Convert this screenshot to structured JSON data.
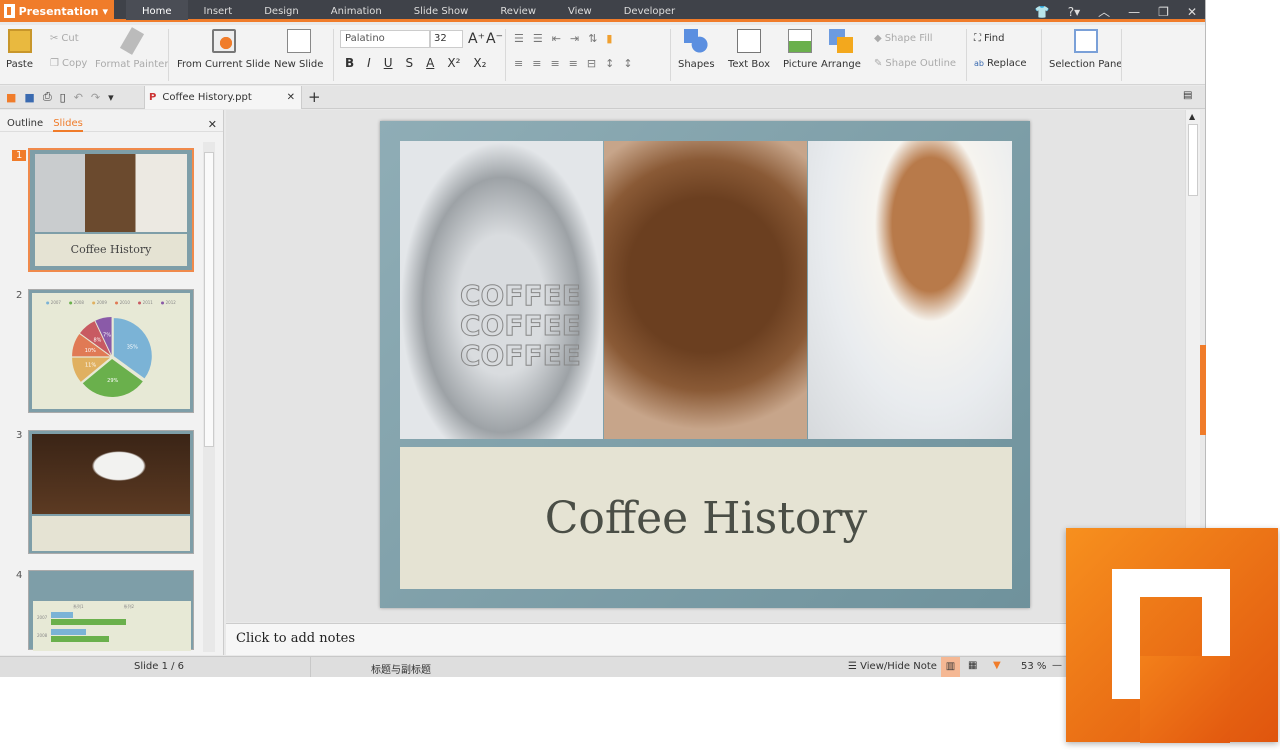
{
  "app": {
    "name": "Presentation",
    "tabs": [
      "Home",
      "Insert",
      "Design",
      "Animation",
      "Slide Show",
      "Review",
      "View",
      "Developer"
    ],
    "active_tab": "Home",
    "accent": "#f07c2a"
  },
  "ribbon": {
    "paste": "Paste",
    "cut": "Cut",
    "copy": "Copy",
    "format_painter": "Format Painter",
    "from_current_slide": "From Current Slide",
    "new_slide": "New Slide",
    "font": "Palatino",
    "font_size": "32",
    "bold": "B",
    "italic": "I",
    "underline": "U",
    "strike": "S",
    "font_color": "A",
    "superscript": "X²",
    "subscript": "X₂",
    "shapes": "Shapes",
    "text_box": "Text Box",
    "picture": "Picture",
    "arrange": "Arrange",
    "shape_fill": "Shape Fill",
    "shape_outline": "Shape Outline",
    "find": "Find",
    "replace": "Replace",
    "selection_pane": "Selection Pane"
  },
  "document": {
    "tab_title": "Coffee History.ppt"
  },
  "panel": {
    "tabs": [
      "Outline",
      "Slides"
    ],
    "active": "Slides",
    "thumbs": [
      {
        "num": "1",
        "caption": "Coffee History"
      },
      {
        "num": "2",
        "legend": [
          "2007",
          "2008",
          "2009",
          "2010",
          "2011",
          "2012"
        ],
        "values": [
          "35%",
          "29%",
          "11%",
          "10%",
          "8%",
          "7%"
        ]
      },
      {
        "num": "3"
      },
      {
        "num": "4",
        "legend": [
          "系列1",
          "系列2"
        ],
        "rows": [
          "2007",
          "2008"
        ]
      }
    ]
  },
  "slide": {
    "title": "Coffee History",
    "photos": [
      "COFFEE canister",
      "coffee beans",
      "cappuccino cup"
    ]
  },
  "notes": {
    "placeholder": "Click to add notes"
  },
  "status": {
    "slide": "Slide 1 / 6",
    "layout": "标题与副标题",
    "view_hide_note": "View/Hide Note",
    "zoom": "53 %"
  }
}
